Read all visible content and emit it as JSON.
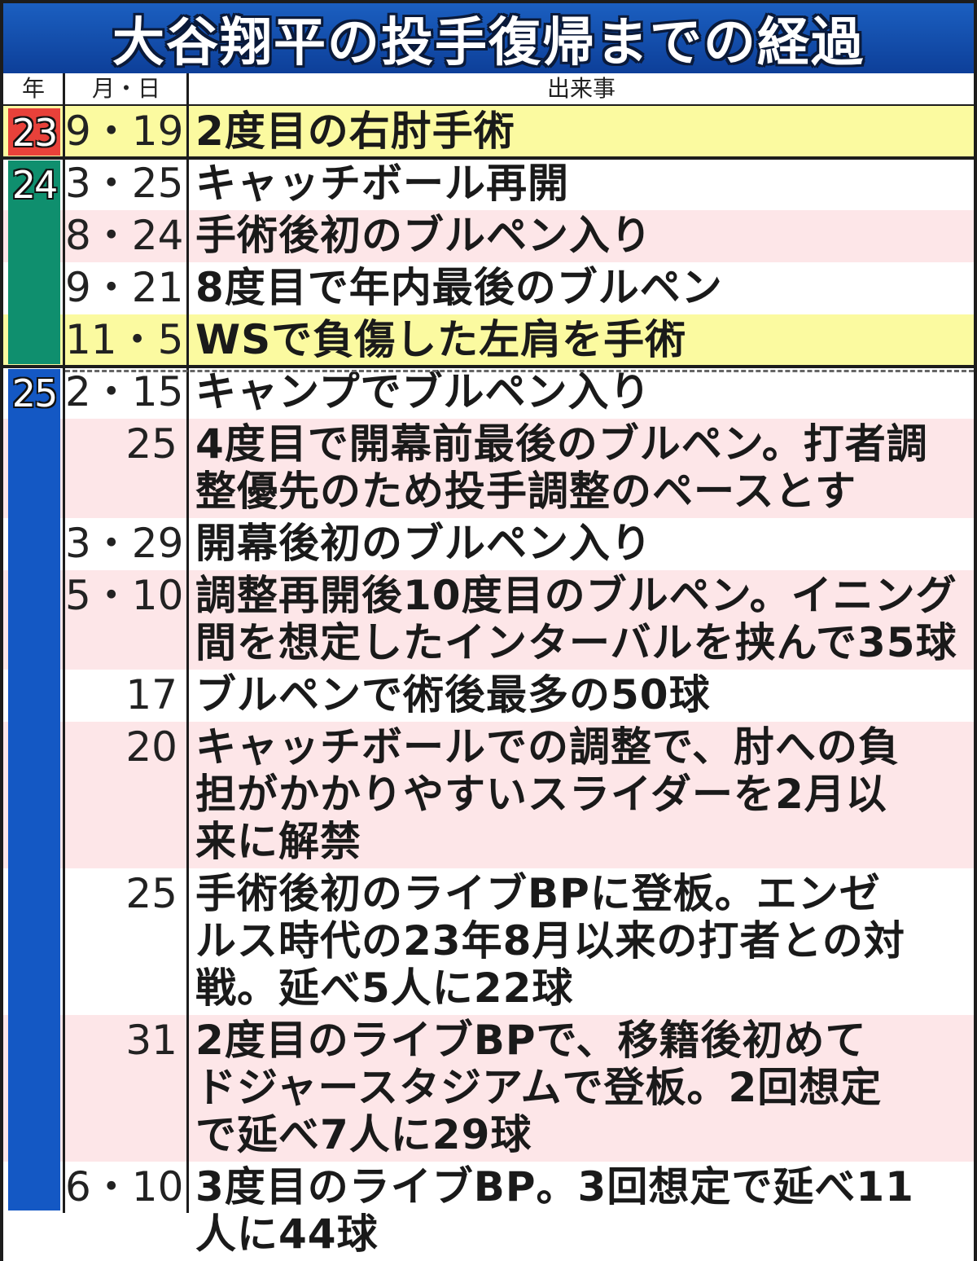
{
  "title": "大谷翔平の投手復帰までの経過",
  "headers": {
    "year": "年",
    "date": "月・日",
    "event": "出来事"
  },
  "years": [
    {
      "label": "23",
      "color": "#e8413a"
    },
    {
      "label": "24",
      "color": "#0f8f6e"
    },
    {
      "label": "25",
      "color": "#1458c4"
    }
  ],
  "rows": [
    {
      "date": "9・19",
      "event": "2度目の右肘手術",
      "bg": "yellow"
    },
    {
      "date": "3・25",
      "event": "キャッチボール再開",
      "bg": "white"
    },
    {
      "date": "8・24",
      "event": "手術後初のブルペン入り",
      "bg": "pink"
    },
    {
      "date": "9・21",
      "event": "8度目で年内最後のブルペン",
      "bg": "white"
    },
    {
      "date": "11・5",
      "event": "WSで負傷した左肩を手術",
      "bg": "yellow"
    },
    {
      "date": "2・15",
      "event": "キャンプでブルペン入り",
      "bg": "white"
    },
    {
      "date": "25",
      "event": "4度目で開幕前最後のブルペン。打者調\n整優先のため投手調整のペースとす",
      "bg": "pink"
    },
    {
      "date": "3・29",
      "event": "開幕後初のブルペン入り",
      "bg": "white"
    },
    {
      "date": "5・10",
      "event": "調整再開後10度目のブルペン。イニング\n間を想定したインターバルを挟んで35球",
      "bg": "pink"
    },
    {
      "date": "17",
      "event": "ブルペンで術後最多の50球",
      "bg": "white"
    },
    {
      "date": "20",
      "event": "キャッチボールでの調整で、肘への負\n担がかかりやすいスライダーを2月以\n来に解禁",
      "bg": "pink"
    },
    {
      "date": "25",
      "event": "手術後初のライブBPに登板。エンゼ\nルス時代の23年8月以来の打者との対\n戦。延べ5人に22球",
      "bg": "white"
    },
    {
      "date": "31",
      "event": "2度目のライブBPで、移籍後初めて\nドジャースタジアムで登板。2回想定\nで延べ7人に29球",
      "bg": "pink"
    },
    {
      "date": "6・10",
      "event": "3度目のライブBP。3回想定で延べ11\n人に44球",
      "bg": "white"
    }
  ]
}
